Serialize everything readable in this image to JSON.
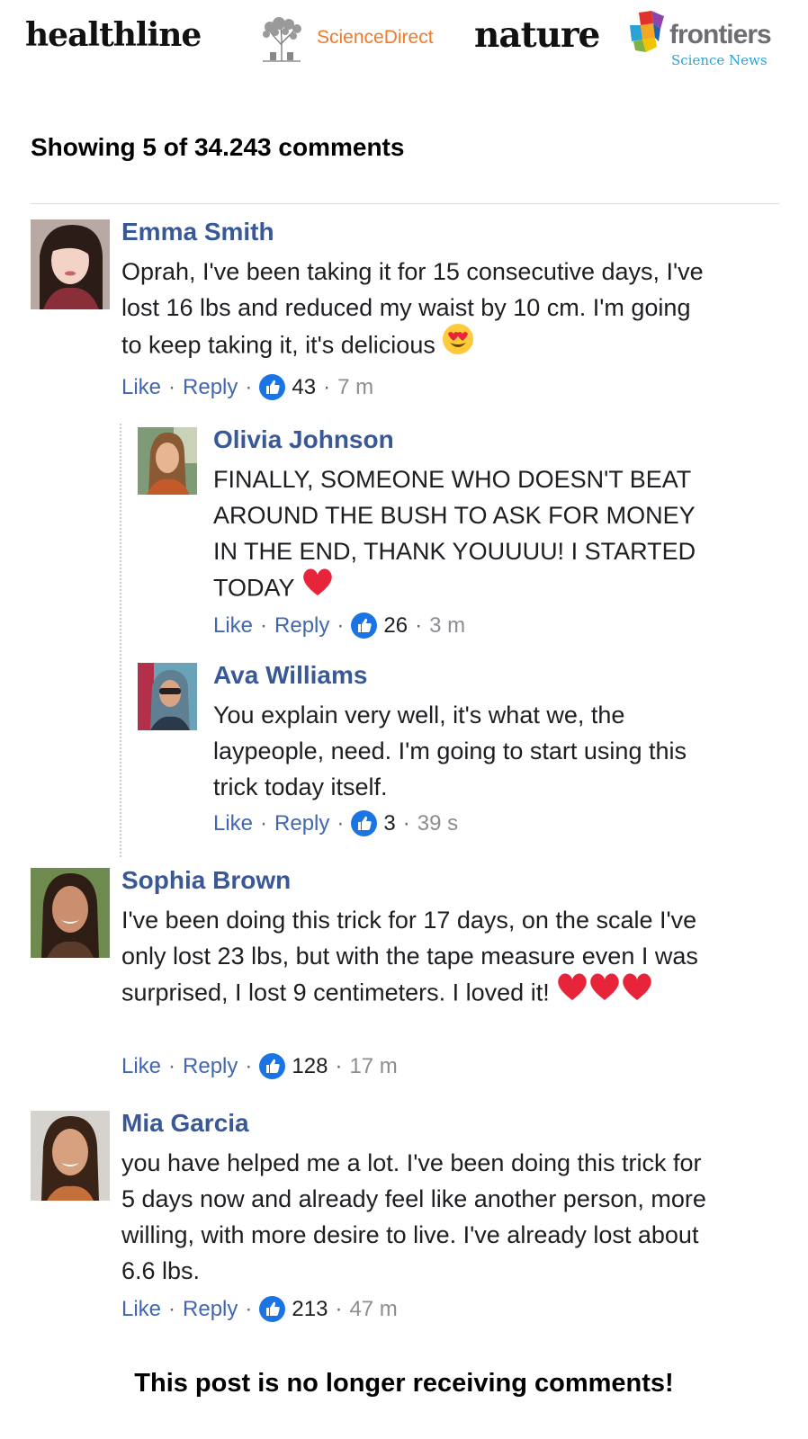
{
  "logos": {
    "healthline": "healthline",
    "sciencedirect": "ScienceDirect",
    "nature": "nature",
    "frontiers": "frontiers",
    "frontiers_sub": "Science News"
  },
  "header": {
    "count_text": "Showing 5 of 34.243 comments"
  },
  "labels": {
    "like": "Like",
    "reply": "Reply",
    "sep": "·"
  },
  "comments": [
    {
      "author": "Emma Smith",
      "text": "Oprah, I've been taking it for 15 consecutive days, I've lost 16 lbs and reduced my waist by 10 cm. I'm going to keep taking it, it's delicious",
      "emoji": "heart-eyes-emoji",
      "likes": "43",
      "time": "7 m"
    },
    {
      "author": "Olivia Johnson",
      "text": "FINALLY, SOMEONE WHO DOESN'T BEAT AROUND THE BUSH TO ASK FOR MONEY IN THE END, THANK YOUUUU! I STARTED TODAY",
      "emoji": "red-heart-emoji",
      "likes": "26",
      "time": "3 m"
    },
    {
      "author": "Ava Williams",
      "text": "You explain very well, it's what we, the laypeople, need. I'm going to start using this trick today itself.",
      "likes": "3",
      "time": "39 s"
    },
    {
      "author": "Sophia Brown",
      "text": "I've been doing this trick for 17 days, on the scale I've only lost 23 lbs, but with the tape measure even I was surprised, I lost 9 centimeters. I loved it!",
      "emoji": "red-heart-emoji",
      "likes": "128",
      "time": "17 m"
    },
    {
      "author": "Mia Garcia",
      "text": "you have helped me a lot. I've been doing this trick for 5 days now and already feel like another person, more willing, with more desire to live. I've already lost about 6.6 lbs.",
      "likes": "213",
      "time": "47 m"
    }
  ],
  "footer": {
    "closed_text": "This post is no longer receiving comments!"
  },
  "colors": {
    "author": "#385898",
    "link": "#4267b2",
    "like_badge": "#1b74e4",
    "time": "#8a8d91"
  }
}
